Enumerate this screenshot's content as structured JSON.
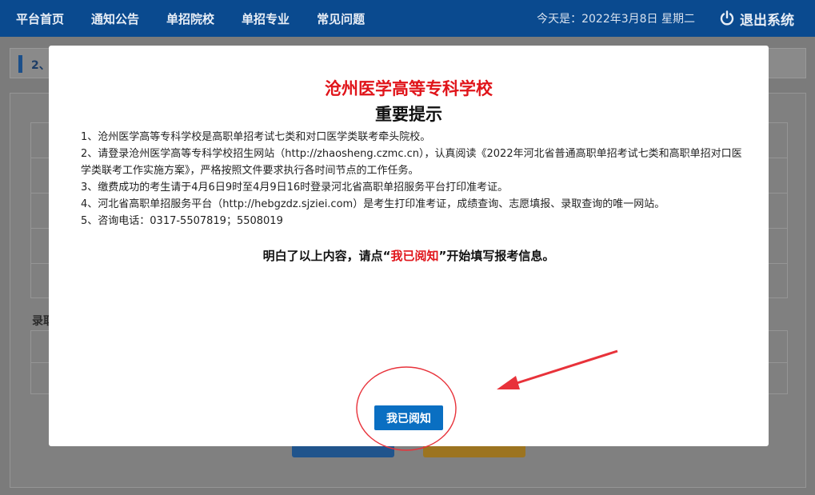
{
  "nav": {
    "items": [
      "平台首页",
      "通知公告",
      "单招院校",
      "单招专业",
      "常见问题"
    ],
    "date_text": "今天是：2022年3月8日 星期二",
    "logout_label": "退出系统"
  },
  "background": {
    "step_label": "2、",
    "section_label": "录取"
  },
  "modal": {
    "school_name": "沧州医学高等专科学校",
    "heading": "重要提示",
    "items": [
      "1、沧州医学高等专科学校是高职单招考试七类和对口医学类联考牵头院校。",
      "2、请登录沧州医学高等专科学校招生网站（http://zhaosheng.czmc.cn），认真阅读《2022年河北省普通高职单招考试七类和高职单招对口医学类联考工作实施方案》，严格按照文件要求执行各时间节点的工作任务。",
      "3、缴费成功的考生请于4月6日9时至4月9日16时登录河北省高职单招服务平台打印准考证。",
      "4、河北省高职单招服务平台（http://hebgzdz.sjziei.com）是考生打印准考证，成绩查询、志愿填报、录取查询的唯一网站。",
      "5、咨询电话：0317-5507819；5508019"
    ],
    "confirm_prefix": "明白了以上内容，请点“",
    "confirm_highlight": "我已阅知",
    "confirm_suffix": "”开始填写报考信息。",
    "ack_button": "我已阅知"
  },
  "colors": {
    "nav_bg": "#0a4a8f",
    "title_red": "#e0141a",
    "button_blue": "#0a6fc2",
    "annotation_red": "#e8323a"
  }
}
